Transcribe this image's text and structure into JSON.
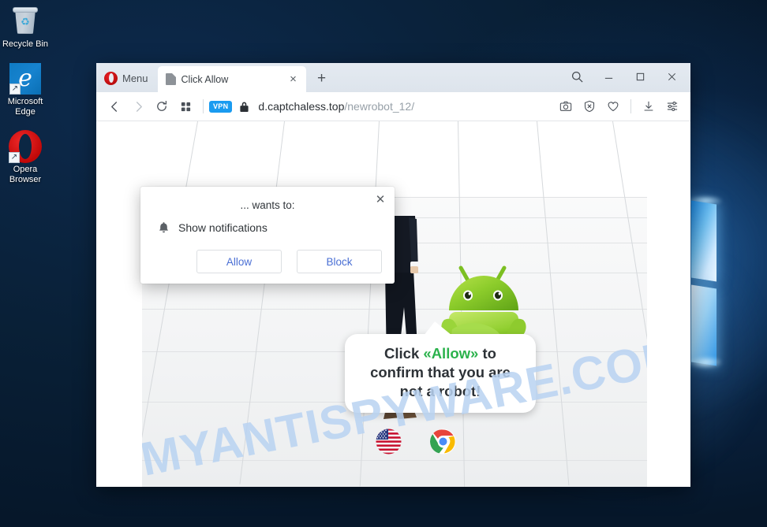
{
  "desktop": {
    "icons": [
      {
        "name": "recycle-bin",
        "label": "Recycle Bin"
      },
      {
        "name": "microsoft-edge",
        "label": "Microsoft Edge"
      },
      {
        "name": "opera-browser",
        "label": "Opera Browser"
      }
    ]
  },
  "browser": {
    "menu_label": "Menu",
    "tab": {
      "title": "Click Allow",
      "close_label": "×"
    },
    "new_tab_label": "+",
    "window_controls": {
      "search": "search-icon",
      "minimize": "—",
      "maximize": "□",
      "close": "✕"
    },
    "address": {
      "host": "d.captchaless.top",
      "path": "/newrobot_12/",
      "vpn_badge": "VPN",
      "lock": "secure-lock-icon"
    },
    "toolbar_icons": [
      "snapshot-camera-icon",
      "ad-blocker-shield-icon",
      "favorites-heart-icon",
      "downloads-icon",
      "easy-setup-icon"
    ],
    "nav_icons": [
      "back-arrow-icon",
      "forward-arrow-icon",
      "reload-icon",
      "speed-dial-icon"
    ]
  },
  "notification_dialog": {
    "title": "... wants to:",
    "permission": "Show notifications",
    "permission_icon": "bell-icon",
    "allow_label": "Allow",
    "block_label": "Block",
    "close_label": "✕",
    "button_text_color": "#4a6fd4"
  },
  "page": {
    "bubble": {
      "line1_pre": "Click ",
      "line1_highlight": "«Allow»",
      "line1_post": " to",
      "line2": "confirm that you are",
      "line3": "not a robot!",
      "highlight_color": "#2bb24c"
    },
    "badges": [
      {
        "name": "us-flag-badge"
      },
      {
        "name": "chrome-logo-badge"
      }
    ],
    "characters": [
      {
        "name": "businessman-figure"
      },
      {
        "name": "android-mascot"
      }
    ]
  },
  "watermark": {
    "text": "MYANTISPYWARE.COM",
    "color": "#b9d3f2"
  }
}
